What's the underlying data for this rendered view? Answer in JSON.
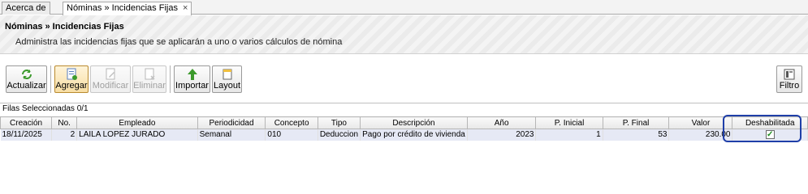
{
  "tabs": [
    {
      "label": "Acerca de"
    },
    {
      "label": "Nóminas » Incidencias Fijas",
      "close": "×"
    }
  ],
  "header": {
    "title": "Nóminas » Incidencias Fijas",
    "subtitle": "Administra las incidencias fijas que se aplicarán a uno o varios cálculos de nómina"
  },
  "toolbar": {
    "actualizar": "Actualizar",
    "agregar": "Agregar",
    "modificar": "Modificar",
    "eliminar": "Eliminar",
    "importar": "Importar",
    "layout": "Layout",
    "filtro": "Filtro"
  },
  "grid": {
    "selection": "Filas Seleccionadas 0/1",
    "columns": [
      "Creación",
      "No.",
      "Empleado",
      "Periodicidad",
      "Concepto",
      "Tipo",
      "Descripción",
      "Año",
      "P. Inicial",
      "P. Final",
      "Valor",
      "Deshabilitada"
    ],
    "rows": [
      {
        "creacion": "18/11/2025",
        "no": "2",
        "empleado": "LAILA LOPEZ JURADO",
        "periodicidad": "Semanal",
        "concepto": "010",
        "tipo": "Deduccion",
        "descripcion": "Pago por crédito de vivienda",
        "anio": "2023",
        "p_inicial": "1",
        "p_final": "53",
        "valor": "230.00",
        "deshabilitada": "✓"
      }
    ]
  },
  "colors": {
    "highlight": "#1f3fa8",
    "selected_row": "#e6e9f5",
    "check": "#1b8a1b"
  }
}
